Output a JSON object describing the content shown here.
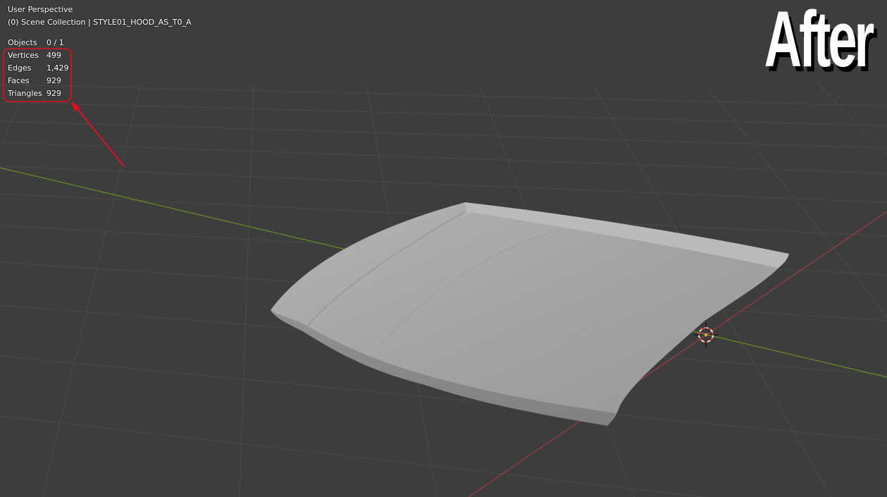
{
  "viewport": {
    "view_name": "User Perspective",
    "collection_path": "(0) Scene Collection | STYLE01_HOOD_AS_T0_A"
  },
  "stats": [
    {
      "label": "Objects",
      "value": "0 / 1"
    },
    {
      "label": "Vertices",
      "value": "499"
    },
    {
      "label": "Edges",
      "value": "1,429"
    },
    {
      "label": "Faces",
      "value": "929"
    },
    {
      "label": "Triangles",
      "value": "929"
    }
  ],
  "overlay": {
    "title": "After"
  },
  "colors": {
    "background": "#3d3d3d",
    "grid": "#4a4a4a",
    "x_axis": "#a33a44",
    "y_axis": "#6b8e23",
    "highlight": "#e0101c",
    "mesh": "#a3a3a3"
  },
  "icons": {
    "cursor": "3d-cursor-icon",
    "arrow": "annotation-arrow-icon"
  }
}
